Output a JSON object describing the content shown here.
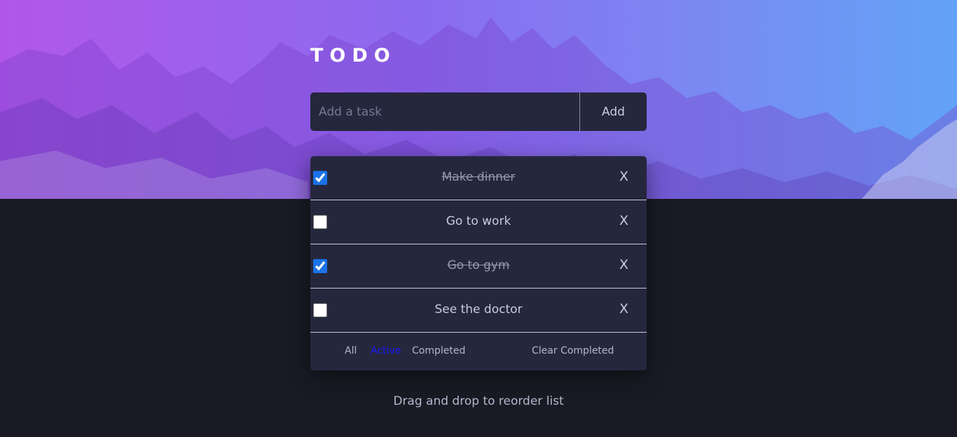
{
  "app": {
    "title": "TODO",
    "hint": "Drag and drop to reorder list"
  },
  "input": {
    "placeholder": "Add a task",
    "value": "",
    "add_label": "Add"
  },
  "tasks": [
    {
      "text": "Make dinner",
      "completed": true,
      "delete_label": "X"
    },
    {
      "text": "Go to work",
      "completed": false,
      "delete_label": "X"
    },
    {
      "text": "Go to gym",
      "completed": true,
      "delete_label": "X"
    },
    {
      "text": "See the doctor",
      "completed": false,
      "delete_label": "X"
    }
  ],
  "filters": {
    "all": "All",
    "active": "Active",
    "completed": "Completed",
    "selected": "active",
    "clear_completed": "Clear Completed"
  },
  "colors": {
    "background": "#191a24",
    "card": "#25273d",
    "text": "#c8cae0",
    "active_filter": "#1a1aff",
    "checkbox": "#1a73e8"
  }
}
